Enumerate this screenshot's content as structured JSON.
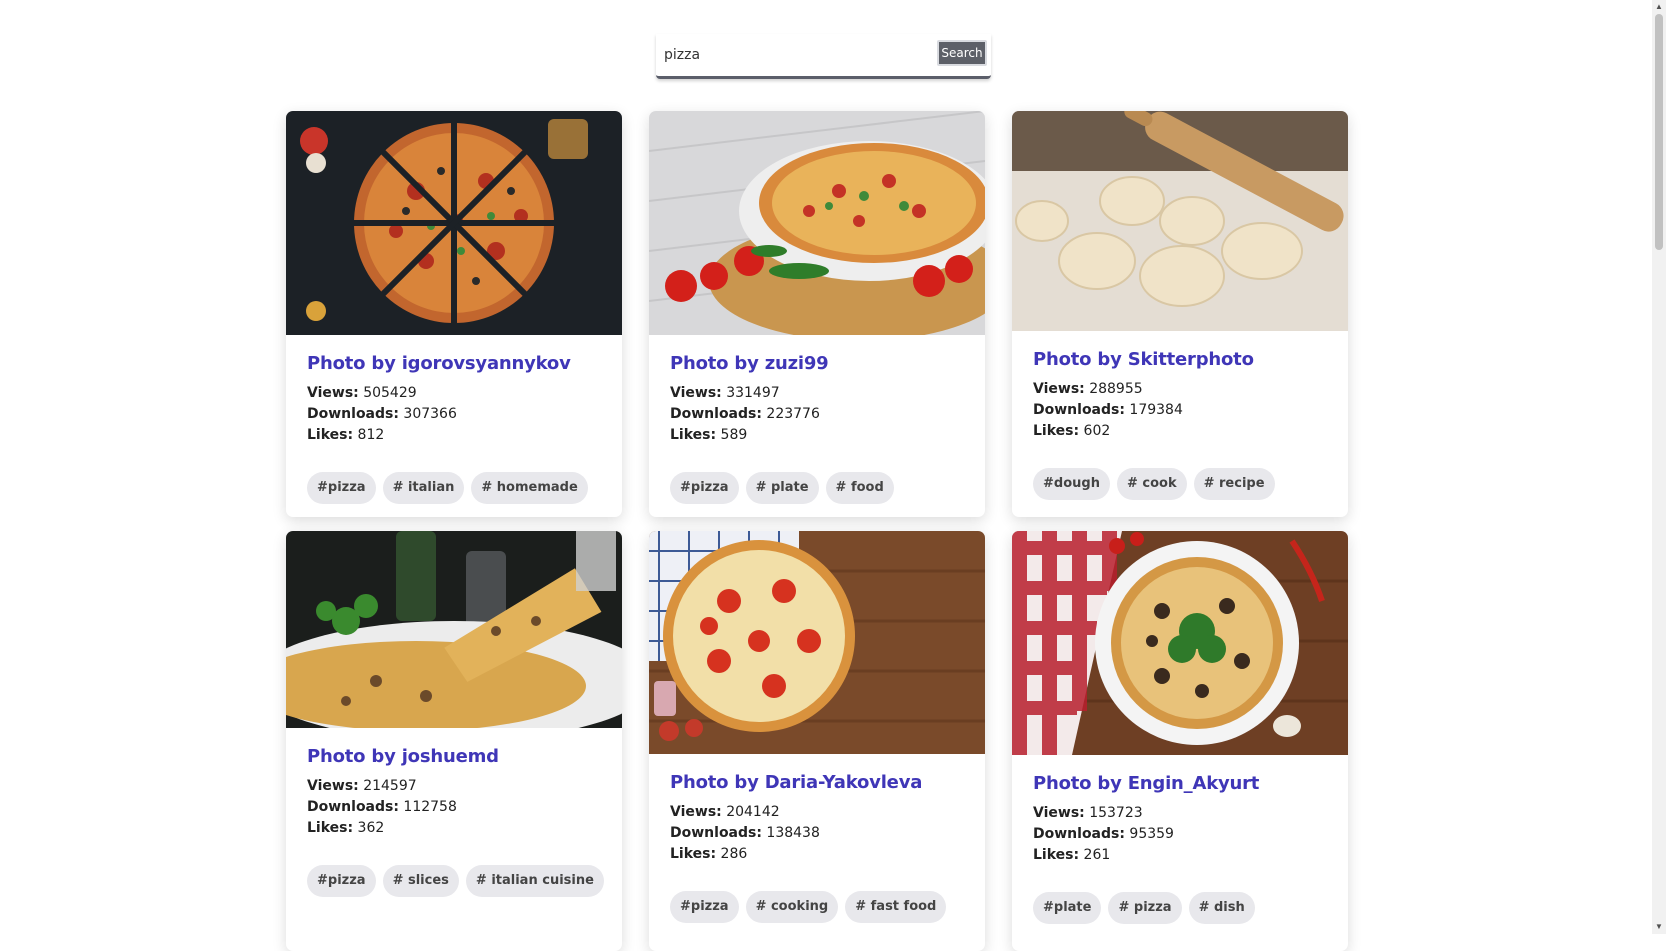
{
  "search": {
    "value": "pizza",
    "button_label": "Search"
  },
  "cards": [
    {
      "author": "Photo by igorovsyannykov",
      "views_label": "Views:",
      "views": "505429",
      "downloads_label": "Downloads:",
      "downloads": "307366",
      "likes_label": "Likes:",
      "likes": "812",
      "tags": [
        "#pizza",
        "# italian",
        "# homemade"
      ]
    },
    {
      "author": "Photo by zuzi99",
      "views_label": "Views:",
      "views": "331497",
      "downloads_label": "Downloads:",
      "downloads": "223776",
      "likes_label": "Likes:",
      "likes": "589",
      "tags": [
        "#pizza",
        "# plate",
        "# food"
      ]
    },
    {
      "author": "Photo by Skitterphoto",
      "views_label": "Views:",
      "views": "288955",
      "downloads_label": "Downloads:",
      "downloads": "179384",
      "likes_label": "Likes:",
      "likes": "602",
      "tags": [
        "#dough",
        "# cook",
        "# recipe"
      ]
    },
    {
      "author": "Photo by joshuemd",
      "views_label": "Views:",
      "views": "214597",
      "downloads_label": "Downloads:",
      "downloads": "112758",
      "likes_label": "Likes:",
      "likes": "362",
      "tags": [
        "#pizza",
        "# slices",
        "# italian cuisine"
      ]
    },
    {
      "author": "Photo by Daria-Yakovleva",
      "views_label": "Views:",
      "views": "204142",
      "downloads_label": "Downloads:",
      "downloads": "138438",
      "likes_label": "Likes:",
      "likes": "286",
      "tags": [
        "#pizza",
        "# cooking",
        "# fast food"
      ]
    },
    {
      "author": "Photo by Engin_Akyurt",
      "views_label": "Views:",
      "views": "153723",
      "downloads_label": "Downloads:",
      "downloads": "95359",
      "likes_label": "Likes:",
      "likes": "261",
      "tags": [
        "#plate",
        "# pizza",
        "# dish"
      ]
    }
  ],
  "colors": {
    "author_link": "#3f36b7",
    "tag_bg": "#e8e8ec",
    "search_button": "#5d6068"
  }
}
